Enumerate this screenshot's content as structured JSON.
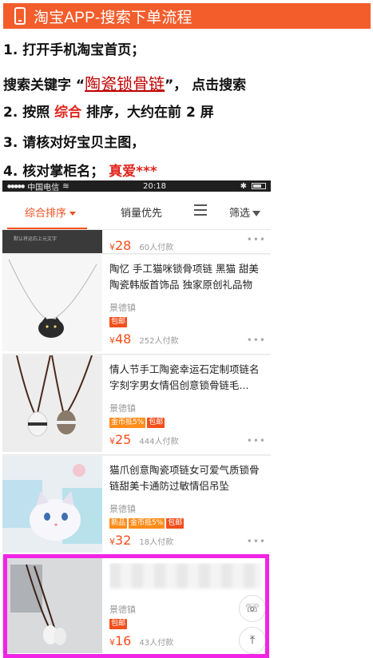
{
  "header": {
    "title": "淘宝APP-搜索下单流程",
    "icon": "phone-icon"
  },
  "steps": {
    "s1": "1. 打开手机淘宝首页；",
    "s1b_prefix": "搜索关键字 “",
    "s1b_keyword": "陶瓷锁骨链",
    "s1b_suffix": "”， 点击搜索",
    "s2_prefix": "2. 按照 ",
    "s2_highlight": "综合",
    "s2_suffix": " 排序，大约在前 2 屏",
    "s3": "3. 请核对好宝贝主图，",
    "s4_prefix": "4. 核对掌柜名；",
    "s4_highlight": "真爱***"
  },
  "phone": {
    "status": {
      "carrier": "中国电信",
      "time": "20:18"
    },
    "sortbar": {
      "comprehensive": "综合排序",
      "sales": "销量优先",
      "filter": "筛选"
    },
    "partial_item": {
      "yen": "¥",
      "price": "28",
      "paid": "60人付款",
      "caption": "默认将运石上元文字"
    },
    "items": [
      {
        "title": "陶忆 手工猫咪锁骨项链 黑猫 甜美陶瓷韩版首饰品 独家原创礼品物",
        "shop": "景德镇",
        "tags": [
          "包邮"
        ],
        "yen": "¥",
        "price": "48",
        "paid": "252人付款"
      },
      {
        "title": "情人节手工陶瓷幸运石定制项链名字刻字男女情侣创意锁骨链毛...",
        "shop": "景德镇",
        "tags": [
          "金币抵5%",
          "包邮"
        ],
        "yen": "¥",
        "price": "25",
        "paid": "444人付款"
      },
      {
        "title": "猫爪创意陶瓷项链女可爱气质锁骨链甜美卡通防过敏情侣吊坠",
        "shop": "景德镇",
        "tags": [
          "新品",
          "金币抵5%",
          "包邮"
        ],
        "yen": "¥",
        "price": "32",
        "paid": "18人付款"
      },
      {
        "title": "",
        "shop": "景德镇",
        "tags": [
          "包邮"
        ],
        "yen": "¥",
        "price": "16",
        "paid": "43人付款"
      }
    ],
    "more": "•••"
  },
  "colors": {
    "brand": "#f35d2c",
    "accent": "#f34e1c",
    "keyword": "#c00000",
    "highlight_border": "#f124e5"
  }
}
